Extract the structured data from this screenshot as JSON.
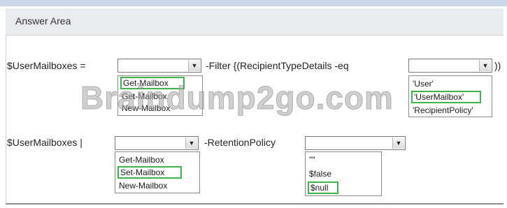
{
  "header": {
    "title": "Answer Area"
  },
  "row1": {
    "label": "$UserMailboxes =",
    "filter_text": "-Filter {(RecipientTypeDetails -eq",
    "closing": "))",
    "dropdown1": {
      "value": "",
      "options": [
        "Get-Mailbox",
        "Get-Mailbox",
        "New-Mailbox"
      ],
      "selected_index": 0
    },
    "dropdown2": {
      "value": "",
      "options": [
        "'User'",
        "'UserMailbox'",
        "'RecipientPolicy'"
      ],
      "selected_index": 1
    }
  },
  "row2": {
    "label": "$UserMailboxes |",
    "policy_text": "-RetentionPolicy",
    "dropdown1": {
      "value": "",
      "options": [
        "Get-Mailbox",
        "Set-Mailbox",
        "New-Mailbox"
      ],
      "selected_index": 1
    },
    "dropdown2": {
      "value": "",
      "options": [
        "\"\"",
        "$false",
        "$null"
      ],
      "selected_index": 2
    }
  },
  "watermark": "Braindump2go.com",
  "colors": {
    "selection_border": "#3cb44a",
    "header_bg": "#e9ecef",
    "top_rule": "#c9d7e8"
  }
}
